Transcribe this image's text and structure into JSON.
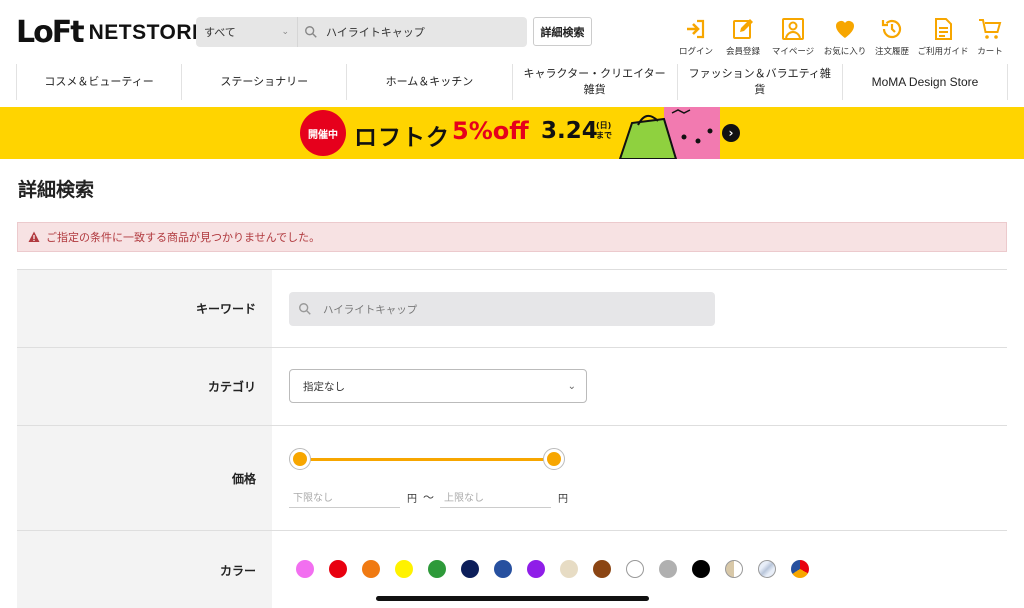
{
  "header": {
    "logo_mark": "LoFt",
    "logo_text": "NETSTORE",
    "search_category": "すべて",
    "search_value": "ハイライトキャップ",
    "advanced_search_label": "詳細検索",
    "utility": [
      {
        "label": "ログイン",
        "icon": "login-icon"
      },
      {
        "label": "会員登録",
        "icon": "register-icon"
      },
      {
        "label": "マイページ",
        "icon": "mypage-icon"
      },
      {
        "label": "お気に入り",
        "icon": "heart-icon"
      },
      {
        "label": "注文履歴",
        "icon": "history-icon"
      },
      {
        "label": "ご利用ガイド",
        "icon": "guide-icon"
      },
      {
        "label": "カート",
        "icon": "cart-icon"
      }
    ]
  },
  "nav": {
    "items": [
      "コスメ＆ビューティー",
      "ステーショナリー",
      "ホーム＆キッチン",
      "キャラクター・クリエイター雑貨",
      "ファッション＆バラエティ雑貨",
      "MoMA Design Store"
    ]
  },
  "banner": {
    "badge": "開催中",
    "title": "ロフトク",
    "discount": "5%off",
    "date": "3.24",
    "date_suffix": "(日)まで"
  },
  "page": {
    "title": "詳細検索",
    "alert": "ご指定の条件に一致する商品が見つかりませんでした。"
  },
  "form": {
    "keyword_label": "キーワード",
    "keyword_placeholder": "ハイライトキャップ",
    "category_label": "カテゴリ",
    "category_value": "指定なし",
    "price_label": "価格",
    "price_min_placeholder": "下限なし",
    "price_max_placeholder": "上限なし",
    "price_unit": "円",
    "price_separator": "〜",
    "color_label": "カラー",
    "colors": [
      "#f26ff0",
      "#e8000f",
      "#f07a12",
      "#fff200",
      "#2e9a3a",
      "#0c1e5a",
      "#27509f",
      "#8f1ee8",
      "#e7dcc4",
      "#8b4513",
      "#ffffff",
      "#b0b0b0",
      "#000000",
      "gold-split",
      "silver",
      "multi"
    ]
  },
  "colors": {
    "accent": "#f7a600",
    "banner_bg": "#ffd400",
    "alert_bg": "#f7e2e3",
    "alert_text": "#b13a3f"
  }
}
